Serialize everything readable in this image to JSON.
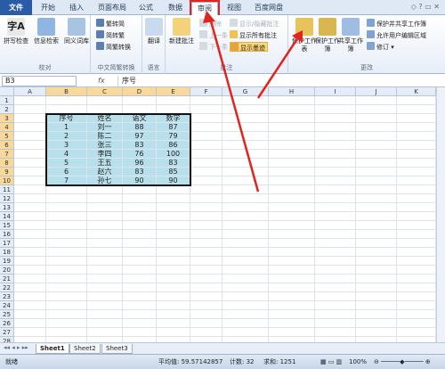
{
  "tabs": [
    "文件",
    "开始",
    "插入",
    "页面布局",
    "公式",
    "数据",
    "审阅",
    "视图",
    "百度网盘"
  ],
  "ribbon": {
    "proofing": {
      "label": "校对",
      "buttons": [
        "拼写检查",
        "信息检索",
        "同义词库"
      ]
    },
    "chinese": {
      "label": "中文简繁转换",
      "buttons": [
        "繁转简",
        "简转繁",
        "简繁转换"
      ]
    },
    "language": {
      "label": "语言",
      "buttons": [
        "翻译"
      ]
    },
    "comments": {
      "label": "批注",
      "buttons": [
        "新建批注",
        "删除",
        "上一条",
        "下一条",
        "显示/隐藏批注",
        "显示所有批注",
        "显示墨迹"
      ]
    },
    "changes": {
      "label": "更改",
      "buttons": [
        "保护工作表",
        "保护工作簿",
        "共享工作簿",
        "保护并共享工作簿",
        "允许用户编辑区域",
        "修订"
      ]
    }
  },
  "formula_bar": {
    "name": "B3",
    "fx": "fx",
    "value": "序号"
  },
  "columns": [
    "A",
    "B",
    "C",
    "D",
    "E",
    "F",
    "G",
    "H",
    "I",
    "J",
    "K"
  ],
  "rows": [
    "1",
    "2",
    "3",
    "4",
    "5",
    "6",
    "7",
    "8",
    "9",
    "10",
    "11",
    "12",
    "13",
    "14",
    "15",
    "16",
    "17",
    "18",
    "19",
    "20",
    "21",
    "22",
    "23",
    "24",
    "25",
    "26",
    "27",
    "28"
  ],
  "table": {
    "headers": [
      "序号",
      "姓名",
      "语文",
      "数学"
    ],
    "rows": [
      [
        "1",
        "刘一",
        "88",
        "87"
      ],
      [
        "2",
        "陈二",
        "97",
        "79"
      ],
      [
        "3",
        "张三",
        "83",
        "86"
      ],
      [
        "4",
        "李四",
        "76",
        "100"
      ],
      [
        "5",
        "王五",
        "96",
        "83"
      ],
      [
        "6",
        "赵六",
        "83",
        "85"
      ],
      [
        "7",
        "孙七",
        "90",
        "90"
      ]
    ]
  },
  "sheets": [
    "Sheet1",
    "Sheet2",
    "Sheet3"
  ],
  "status": {
    "ready": "就绪",
    "average": "平均值: 59.57142857",
    "count": "计数: 32",
    "sum": "求和: 1251",
    "zoom": "100%"
  },
  "colors": {
    "accent": "#2a5ba7",
    "data_fill": "#b7e0ec",
    "arrow": "#e0241e",
    "selected_header": "#f9d99a"
  }
}
